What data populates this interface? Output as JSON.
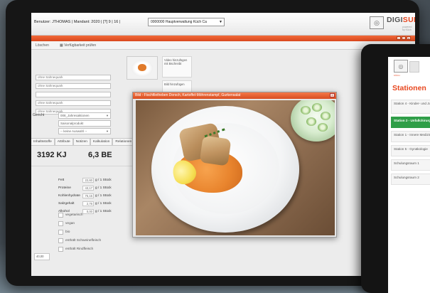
{
  "tablet1": {
    "user_line": "Benutzer: JTHOMAS | Mandant: 2020 | [?] 9 | 16 |",
    "company_select": "0000000 Hauptverwaltung Küch Ca",
    "brand_prefix": "DIGI",
    "brand_suffix": "SUPPLY",
    "brand_sub": "powered by Küch",
    "toolbar": {
      "delete_label": "Löschen",
      "availability_label": "Verfügbarkeit prüfen"
    },
    "form": {
      "fields": [
        "ohne Sahnequark",
        "ohne Sahnequark",
        "",
        "ohne Sahnequark",
        "ohne Sahnequark"
      ],
      "select_1_label": "Gericht",
      "select_1_value": "008_Jahresaktionen",
      "select_2_value": "Saisonalprodukt",
      "select_3_value": "-- keine Auswahl --"
    },
    "side_buttons": [
      "Video hinzufügen mit Bschreibt",
      "Bild hinzufügen",
      "Bild hinz"
    ],
    "tabs": [
      "Inhaltsstoffe",
      "Attribute",
      "Notizen",
      "Kalkulation",
      "Relationen"
    ],
    "energy": "3192 KJ",
    "bread_units": "6,3 BE",
    "nutrients": [
      {
        "label": "Fett",
        "value": "22,60",
        "unit": "g / 1 Stück"
      },
      {
        "label": "Proteine",
        "value": "43,17",
        "unit": "g / 1 Stück"
      },
      {
        "label": "Kohlenhydrate",
        "value": "75,15",
        "unit": "g / 1 Stück"
      },
      {
        "label": "Salzgehalt",
        "value": "2,76",
        "unit": "g / 1 Stück"
      },
      {
        "label": "Alkohol",
        "value": "0,00",
        "unit": "g / 1 Stück"
      }
    ],
    "checks": [
      "vegetarisch",
      "vegan",
      "bio",
      "enthält Schweinefleisch",
      "enthält Rindfleisch"
    ],
    "bottom_field": "40,00"
  },
  "popup": {
    "title": "Bild - Fischfiletheben Dorsch, Kartoffel-Möhrenstampf, Gurkensalat",
    "close_label": "x"
  },
  "tablet2": {
    "sub": "KÜCH",
    "title": "Stationen",
    "items": [
      {
        "label": "Station 4 - Kinder- und Jugendmedizin",
        "active": false
      },
      {
        "label": "Station 2 - Unfallchirurgie",
        "active": true
      },
      {
        "label": "Station 1 - Innere Medizin",
        "active": false
      },
      {
        "label": "Station 5 - Gynäkologie",
        "active": false
      },
      {
        "label": "Schulungsraum 1",
        "active": false
      },
      {
        "label": "Schulungsraum 2",
        "active": false
      }
    ]
  },
  "colors": {
    "accent": "#e8471f",
    "active_green": "#2f9e48"
  }
}
